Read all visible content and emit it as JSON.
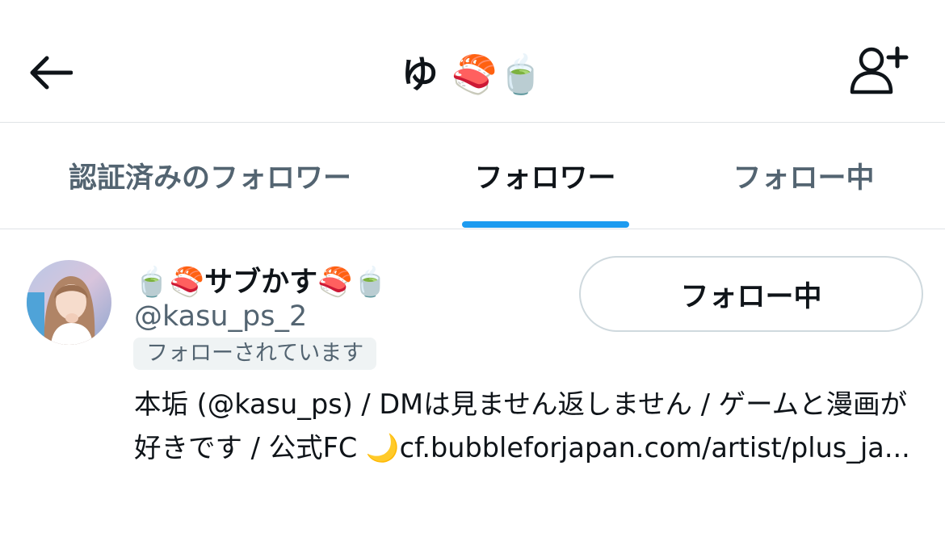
{
  "header": {
    "title": "ゆ 🍣🍵",
    "back_icon": "arrow-left-icon",
    "add_user_icon": "add-user-icon"
  },
  "tabs": [
    {
      "label": "認証済みのフォロワー",
      "active": false
    },
    {
      "label": "フォロワー",
      "active": true
    },
    {
      "label": "フォロー中",
      "active": false
    }
  ],
  "accent_color": "#1d9bf0",
  "user": {
    "display_name": "🍵🍣サブかす🍣🍵",
    "handle": "@kasu_ps_2",
    "follows_you_label": "フォローされています",
    "follow_button_label": "フォロー中",
    "bio": "本垢 (@kasu_ps) / DMは見ません返しません / ゲームと漫画が好きです / 公式FC 🌙cf.bubbleforjapan.com/artist/plus_ja..."
  }
}
